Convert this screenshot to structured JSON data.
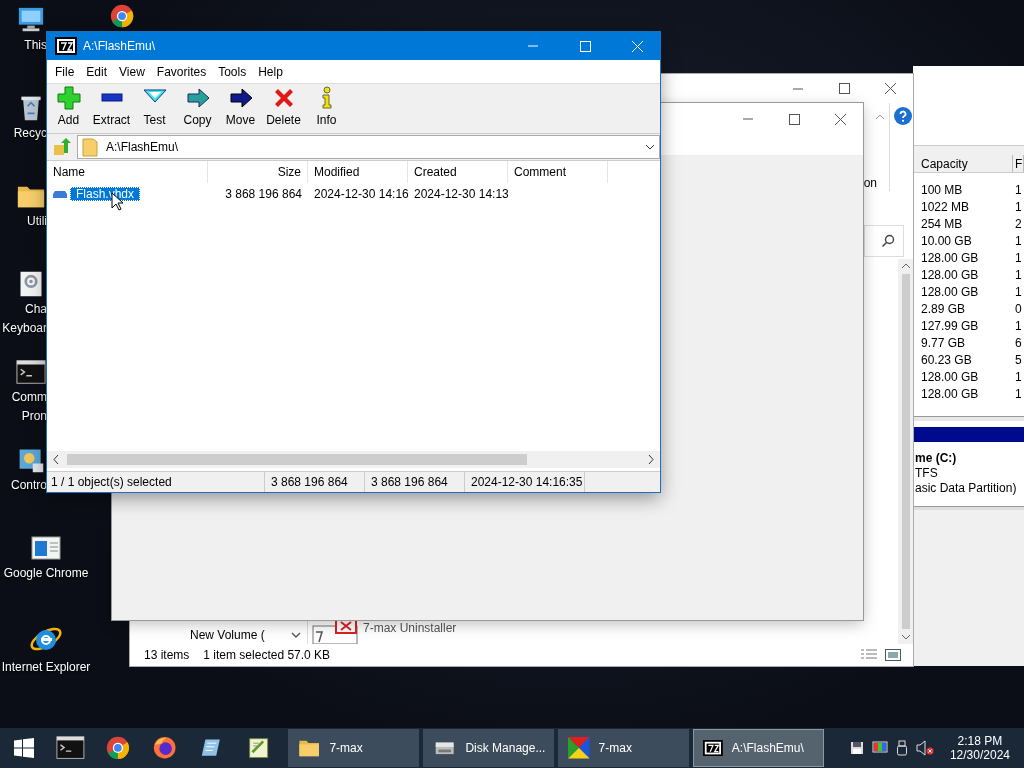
{
  "desktop_icons": [
    {
      "kind": "pc",
      "lines": [
        "This"
      ],
      "clipped": true
    },
    {
      "kind": "recycle",
      "lines": [
        "Recyc"
      ],
      "clipped": true
    },
    {
      "kind": "folder",
      "lines": [
        "Utili"
      ],
      "clipped": true
    },
    {
      "kind": "settings",
      "lines": [
        "Cha",
        "Keyboar"
      ],
      "clipped": true
    },
    {
      "kind": "cmd",
      "lines": [
        "Comm",
        "Pron"
      ],
      "clipped": true
    },
    {
      "kind": "control",
      "lines": [
        "Contro"
      ],
      "clipped": true
    },
    {
      "kind": "window",
      "lines": [
        "Google Chrome"
      ],
      "clipped": false
    },
    {
      "kind": "ie",
      "lines": [
        "Internet Explorer"
      ],
      "clipped": false
    }
  ],
  "desktop_icons_column_2": [
    {
      "kind": "chrome"
    }
  ],
  "disk_window": {
    "columns": [
      "Capacity",
      "F"
    ],
    "rows": [
      [
        "100 MB",
        "1"
      ],
      [
        "1022 MB",
        "1"
      ],
      [
        "254 MB",
        "2"
      ],
      [
        "10.00 GB",
        "1"
      ],
      [
        "128.00 GB",
        "1"
      ],
      [
        "128.00 GB",
        "1"
      ],
      [
        "128.00 GB",
        "1"
      ],
      [
        "2.89 GB",
        "0"
      ],
      [
        "127.99 GB",
        "1"
      ],
      [
        "9.77 GB",
        "6"
      ],
      [
        "60.23 GB",
        "5"
      ],
      [
        "128.00 GB",
        "1"
      ],
      [
        "128.00 GB",
        "1"
      ]
    ],
    "volume_lines": [
      "me  (C:)",
      "TFS",
      "asic Data Partition)"
    ]
  },
  "explorer_window": {
    "ribbon_label": "on",
    "nav_items": [
      "New Volume ("
    ],
    "files": [
      "7-max Uninstaller"
    ],
    "status": [
      "13 items",
      "1 item selected  57.0 KB"
    ]
  },
  "zip_window": {
    "title": "A:\\FlashEmu\\",
    "menu": [
      "File",
      "Edit",
      "View",
      "Favorites",
      "Tools",
      "Help"
    ],
    "toolbar": [
      {
        "label": "Add",
        "kind": "add"
      },
      {
        "label": "Extract",
        "kind": "extract"
      },
      {
        "label": "Test",
        "kind": "test"
      },
      {
        "label": "Copy",
        "kind": "copy"
      },
      {
        "label": "Move",
        "kind": "move"
      },
      {
        "label": "Delete",
        "kind": "delete"
      },
      {
        "label": "Info",
        "kind": "info"
      }
    ],
    "address": "A:\\FlashEmu\\",
    "columns": [
      "Name",
      "Size",
      "Modified",
      "Created",
      "Comment"
    ],
    "rows": [
      {
        "cells": [
          "Flash.vhdx",
          "3 868 196 864",
          "2024-12-30 14:16",
          "2024-12-30 14:13"
        ],
        "selected": true
      }
    ],
    "status": [
      "1 / 1 object(s) selected",
      "3 868 196 864",
      "3 868 196 864",
      "2024-12-30 14:16:35"
    ]
  },
  "taskbar": {
    "pinned": [
      {
        "kind": "cmd"
      },
      {
        "kind": "chrome"
      },
      {
        "kind": "firefox"
      },
      {
        "kind": "pen"
      },
      {
        "kind": "notepad"
      }
    ],
    "tasks": [
      {
        "label": "7-max",
        "kind": "folder",
        "selected": false
      },
      {
        "label": "Disk Manage...",
        "kind": "disk",
        "selected": false
      },
      {
        "label": "7-max",
        "kind": "colors",
        "selected": false
      },
      {
        "label": "A:\\FlashEmu\\",
        "kind": "zip",
        "selected": true
      }
    ],
    "clock": {
      "time": "2:18 PM",
      "date": "12/30/2024"
    }
  }
}
